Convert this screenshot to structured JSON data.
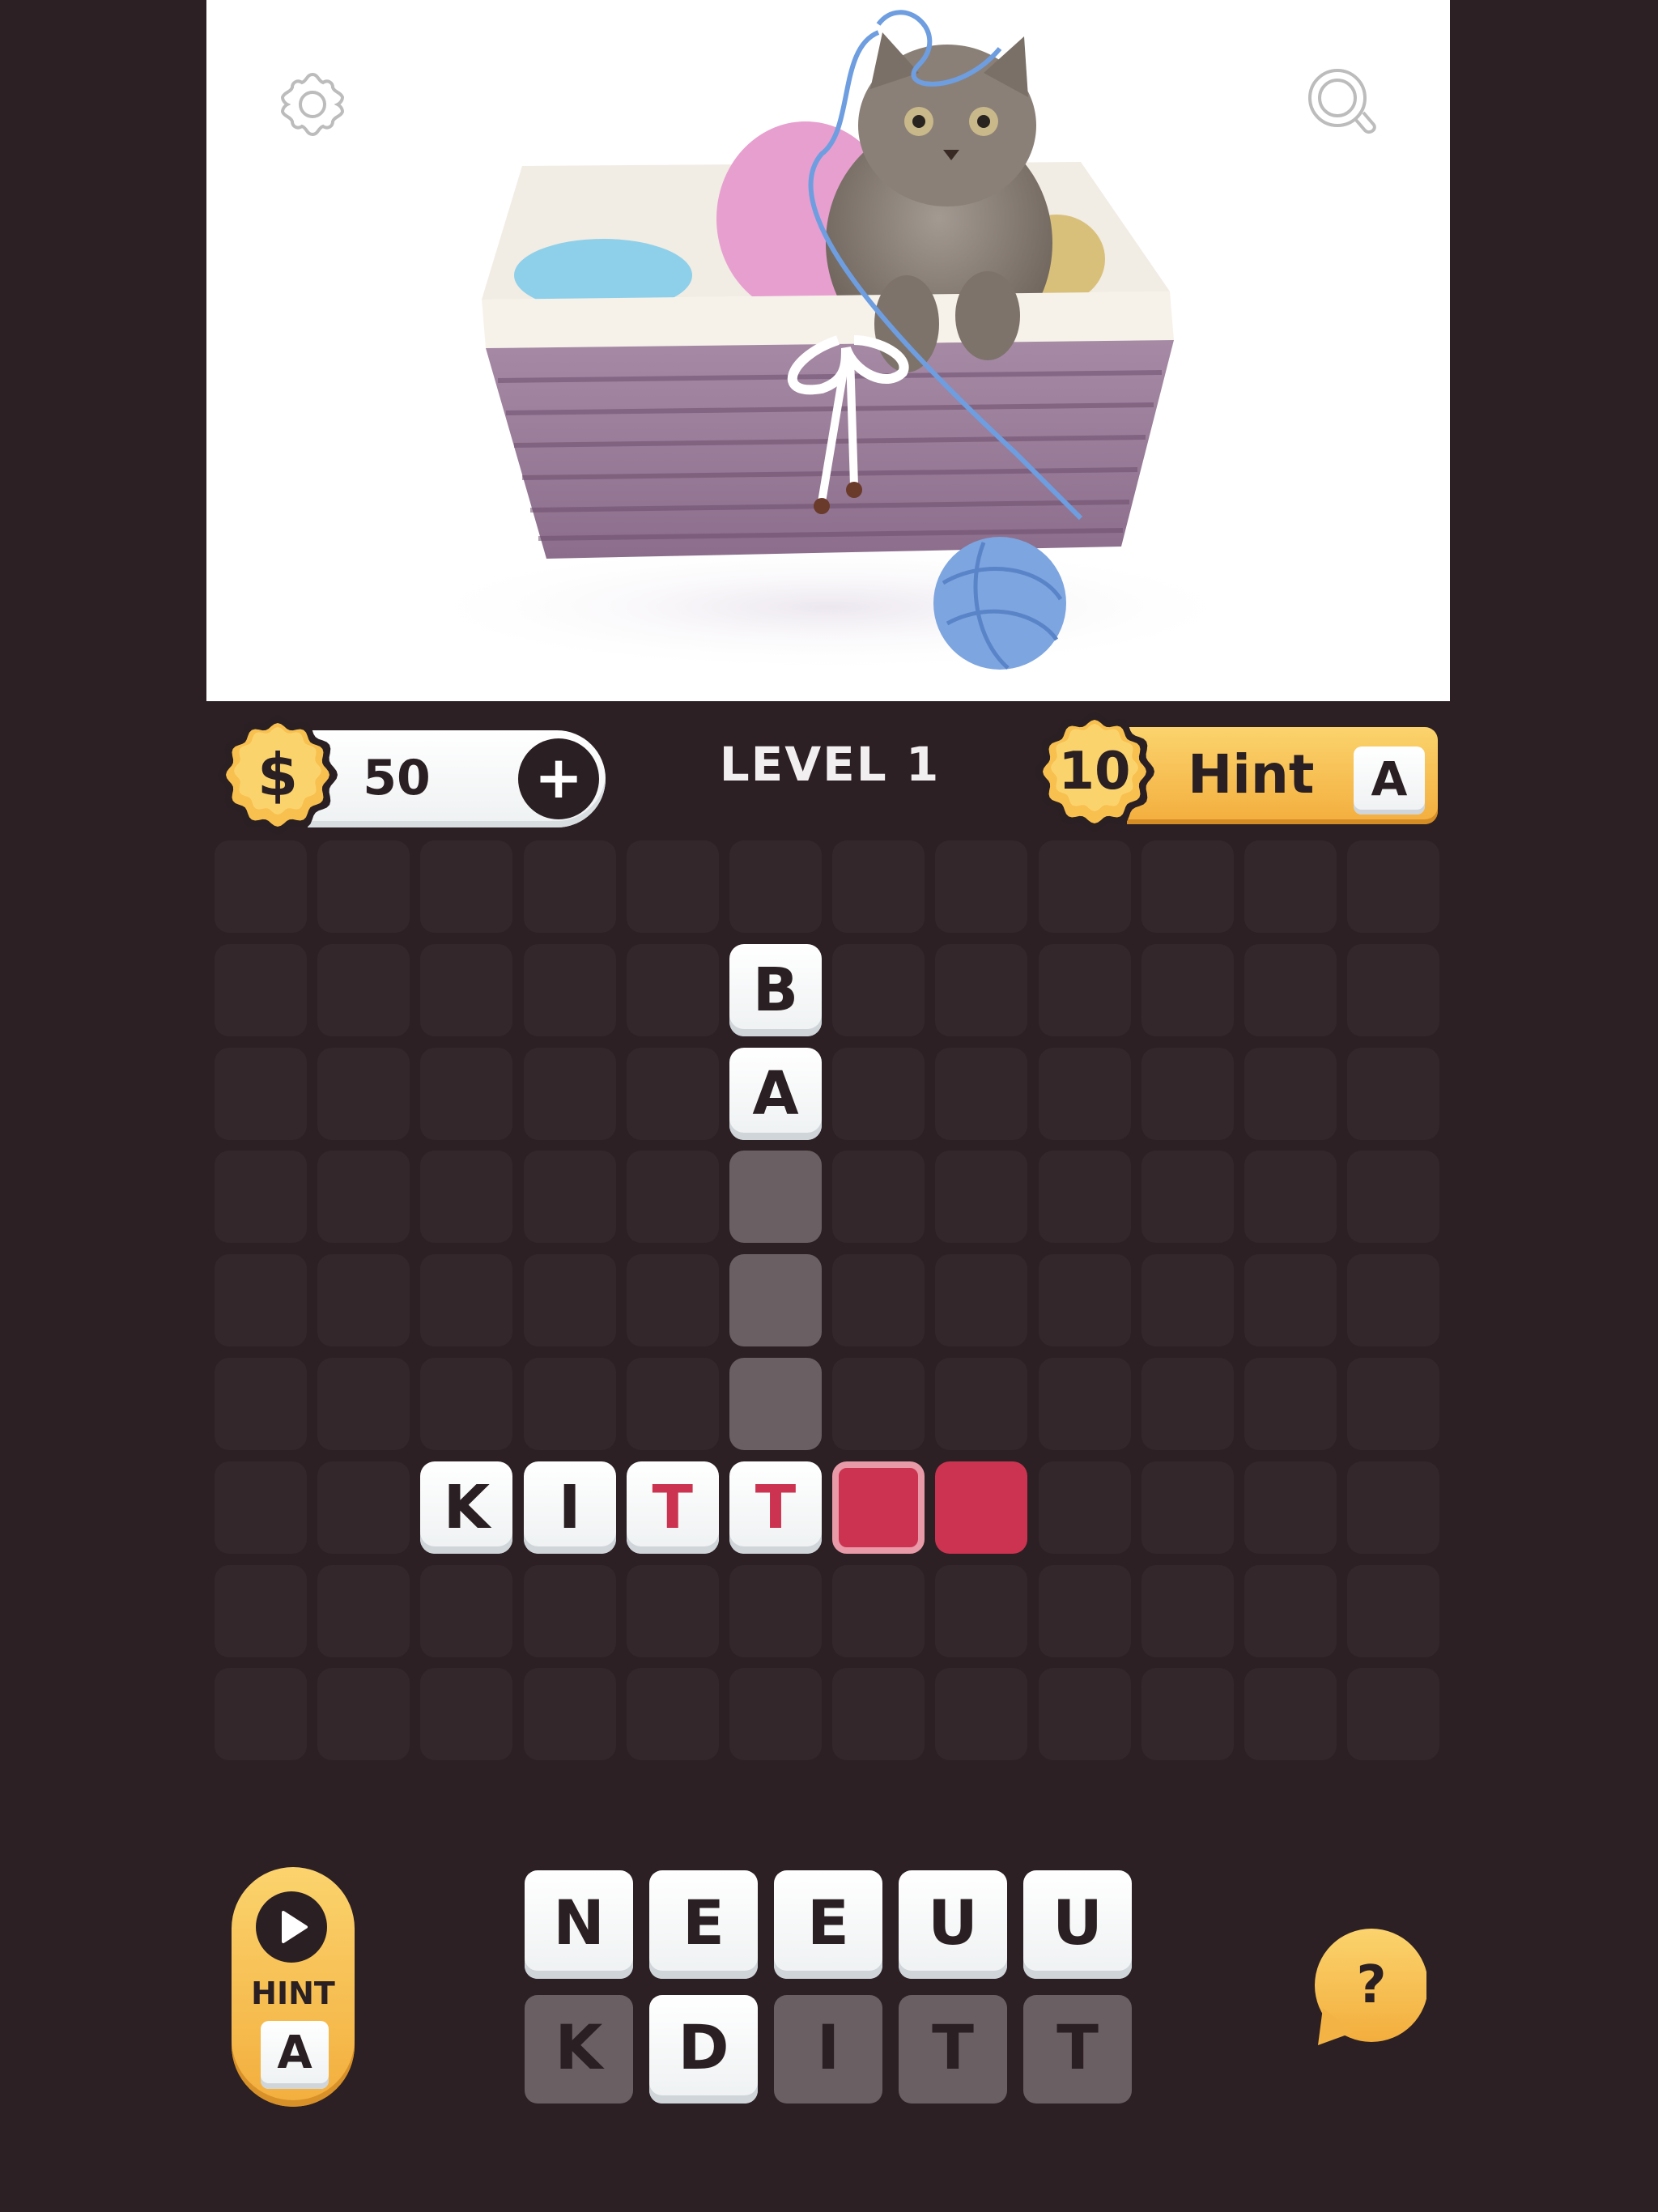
{
  "picture": {
    "subject": "kitten in wicker basket with yarn balls",
    "settings_icon": "gear-icon",
    "zoom_icon": "magnifier-icon"
  },
  "top_bar": {
    "coin_symbol": "$",
    "coins": "50",
    "add_coins_label": "+",
    "level_label": "LEVEL 1",
    "hint_cost": "10",
    "hint_label": "Hint",
    "hint_letter": "A"
  },
  "board": {
    "rows": 9,
    "cols": 12,
    "words": [
      {
        "direction": "down",
        "cells": [
          {
            "row": 1,
            "col": 5,
            "letter": "B",
            "state": "filled"
          },
          {
            "row": 2,
            "col": 5,
            "letter": "A",
            "state": "filled"
          },
          {
            "row": 3,
            "col": 5,
            "letter": "",
            "state": "empty-slot"
          },
          {
            "row": 4,
            "col": 5,
            "letter": "",
            "state": "empty-slot"
          },
          {
            "row": 5,
            "col": 5,
            "letter": "",
            "state": "empty-slot"
          },
          {
            "row": 6,
            "col": 5,
            "letter": "T",
            "state": "filled-red"
          }
        ]
      },
      {
        "direction": "across",
        "cells": [
          {
            "row": 6,
            "col": 2,
            "letter": "K",
            "state": "filled"
          },
          {
            "row": 6,
            "col": 3,
            "letter": "I",
            "state": "filled"
          },
          {
            "row": 6,
            "col": 4,
            "letter": "T",
            "state": "filled-red"
          },
          {
            "row": 6,
            "col": 5,
            "letter": "T",
            "state": "filled-red"
          },
          {
            "row": 6,
            "col": 6,
            "letter": "",
            "state": "active-red-selected"
          },
          {
            "row": 6,
            "col": 7,
            "letter": "",
            "state": "active-red"
          }
        ]
      }
    ]
  },
  "video_hint": {
    "play_icon": "play-icon",
    "label": "HINT",
    "letter": "A"
  },
  "keyboard": {
    "rows": [
      [
        {
          "letter": "N",
          "state": "available"
        },
        {
          "letter": "E",
          "state": "available"
        },
        {
          "letter": "E",
          "state": "available"
        },
        {
          "letter": "U",
          "state": "available"
        },
        {
          "letter": "U",
          "state": "available"
        }
      ],
      [
        {
          "letter": "K",
          "state": "used"
        },
        {
          "letter": "D",
          "state": "available"
        },
        {
          "letter": "I",
          "state": "used"
        },
        {
          "letter": "T",
          "state": "used"
        },
        {
          "letter": "T",
          "state": "used"
        }
      ]
    ]
  },
  "help": {
    "label": "?"
  },
  "colors": {
    "background": "#2c2024",
    "empty_cell": "#33272c",
    "slot_cell": "#6a5f62",
    "accent_red": "#cc3350",
    "accent_red_outline": "#e99aa8",
    "gold_light": "#fbd36d",
    "gold_dark": "#f3ae3d",
    "ink": "#2a1f22"
  }
}
